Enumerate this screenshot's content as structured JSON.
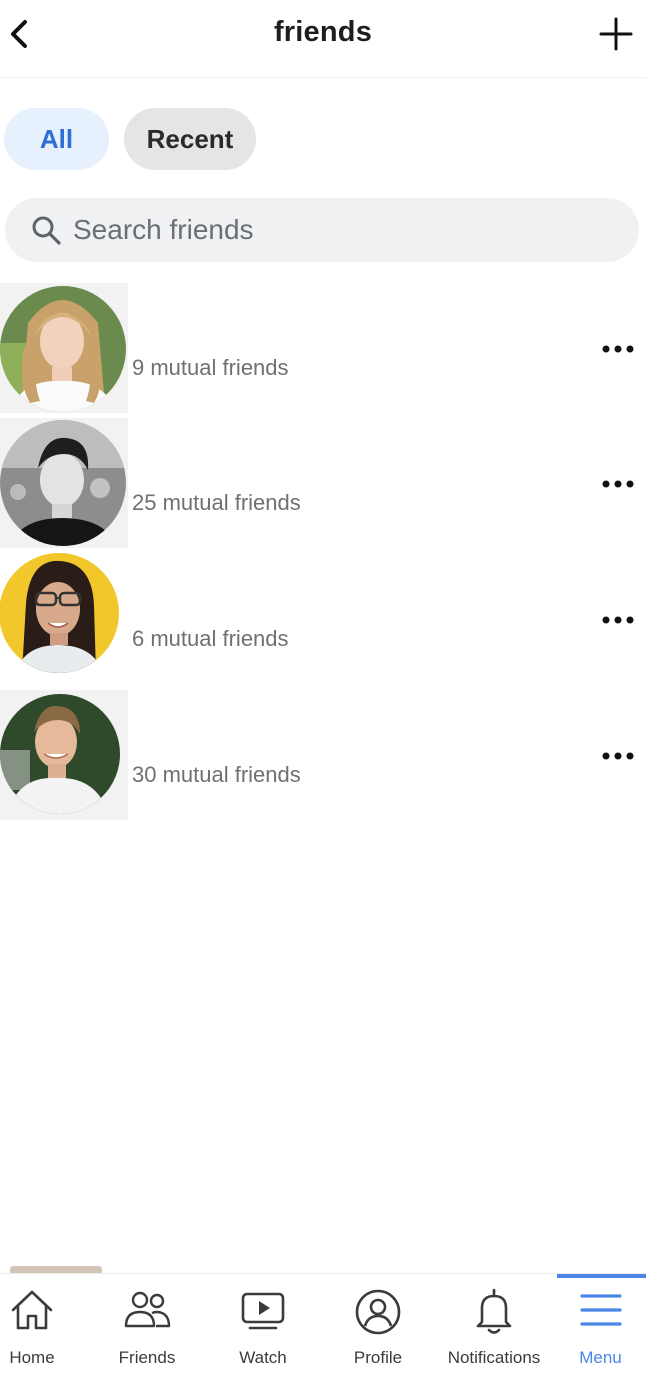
{
  "header": {
    "title": "friends",
    "back_icon": "chevron-left-icon",
    "add_icon": "plus-icon"
  },
  "tabs": [
    {
      "label": "All",
      "selected": true
    },
    {
      "label": "Recent",
      "selected": false
    }
  ],
  "search": {
    "placeholder": "Search friends",
    "value": "",
    "icon": "search-icon"
  },
  "friends": [
    {
      "mutual": "9 mutual friends",
      "more_icon": "more-options-icon"
    },
    {
      "mutual": "25 mutual friends",
      "more_icon": "more-options-icon"
    },
    {
      "mutual": "6 mutual friends",
      "more_icon": "more-options-icon"
    },
    {
      "mutual": "30 mutual friends",
      "more_icon": "more-options-icon"
    }
  ],
  "bottom_nav": {
    "items": [
      {
        "label": "Home",
        "icon": "home-icon",
        "active": false
      },
      {
        "label": "Friends",
        "icon": "friends-icon",
        "active": false
      },
      {
        "label": "Watch",
        "icon": "watch-icon",
        "active": false
      },
      {
        "label": "Profile",
        "icon": "profile-icon",
        "active": false
      },
      {
        "label": "Notifications",
        "icon": "bell-icon",
        "active": false
      },
      {
        "label": "Menu",
        "icon": "menu-icon",
        "active": true
      }
    ]
  },
  "colors": {
    "accent": "#4a86e8",
    "tab_selected_bg": "#e7f0fd",
    "tab_selected_text": "#2f6fd3",
    "tab_unselected_bg": "#e5e5e6",
    "search_bg": "#f0f1f3"
  }
}
